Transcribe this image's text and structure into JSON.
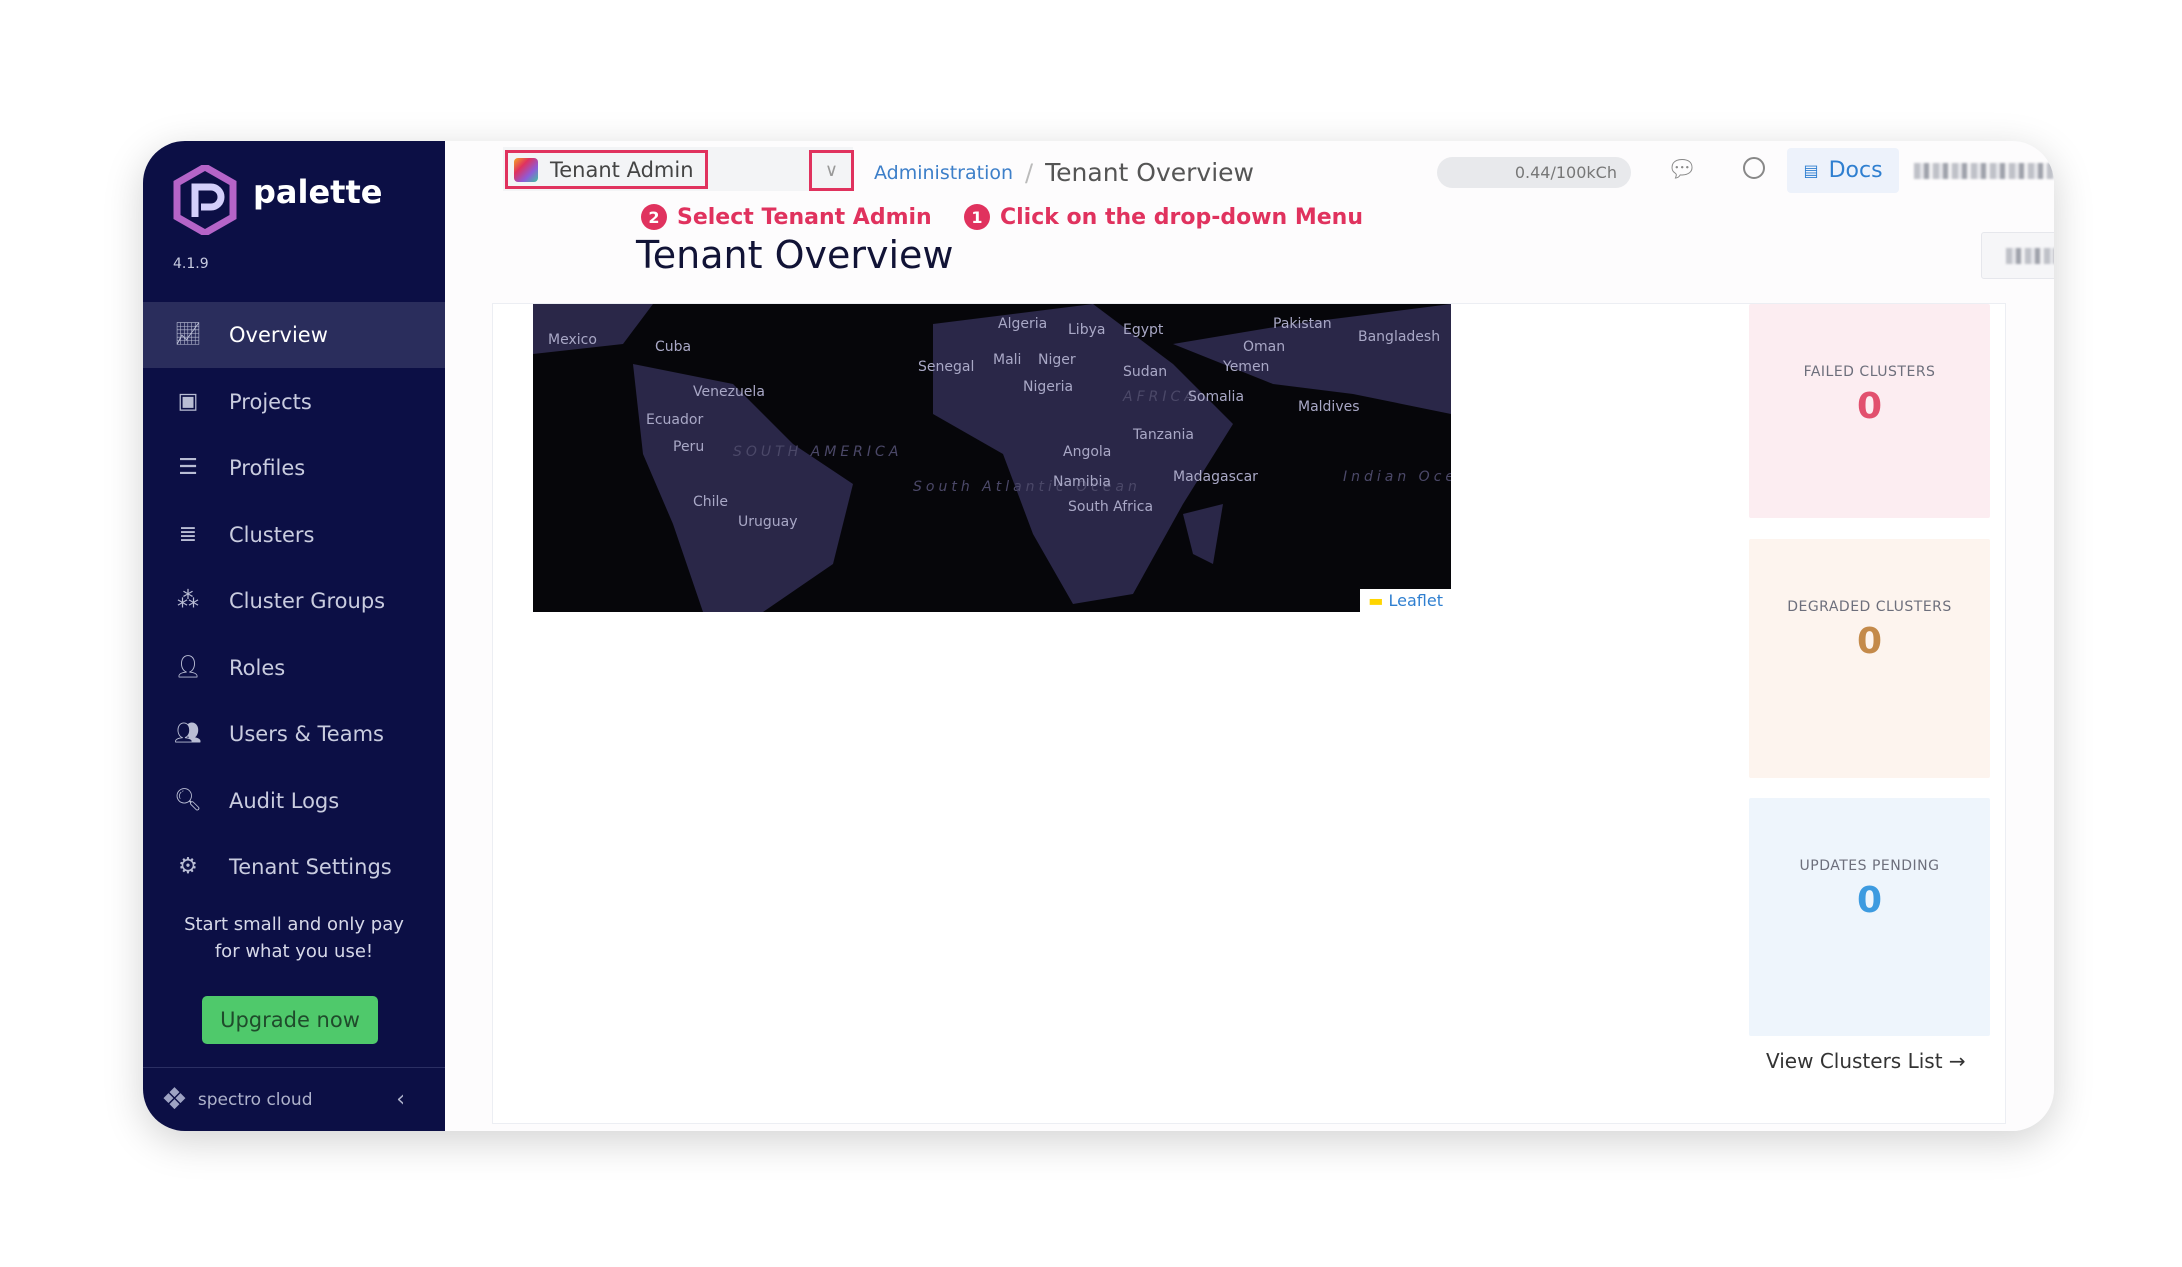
{
  "app": {
    "name": "palette",
    "version": "4.1.9"
  },
  "sidebar": {
    "items": [
      {
        "label": "Overview",
        "icon": "chart-line-icon",
        "active": true
      },
      {
        "label": "Projects",
        "icon": "bar-chart-icon"
      },
      {
        "label": "Profiles",
        "icon": "database-icon"
      },
      {
        "label": "Clusters",
        "icon": "server-icon"
      },
      {
        "label": "Cluster Groups",
        "icon": "network-icon"
      },
      {
        "label": "Roles",
        "icon": "user-lock-icon"
      },
      {
        "label": "Users & Teams",
        "icon": "users-icon"
      },
      {
        "label": "Audit Logs",
        "icon": "file-search-icon"
      },
      {
        "label": "Tenant Settings",
        "icon": "gear-icon"
      }
    ],
    "promo": "Start small and only pay for what you use!",
    "upgrade": "Upgrade now",
    "footer_brand": "spectro cloud"
  },
  "header": {
    "scope": "Tenant Admin",
    "breadcrumb": [
      "Administration",
      "Tenant Overview"
    ],
    "usage": "0.44/100kCh",
    "docs": "Docs"
  },
  "annotations": [
    {
      "num": "2",
      "text": "Select Tenant Admin"
    },
    {
      "num": "1",
      "text": "Click on the drop-down Menu"
    }
  ],
  "page": {
    "title": "Tenant Overview"
  },
  "map": {
    "attribution": "Leaflet",
    "labels": [
      "Mexico",
      "Cuba",
      "Venezuela",
      "Ecuador",
      "Peru",
      "SOUTH AMERICA",
      "Chile",
      "Uruguay",
      "South Atlantic Ocean",
      "Algeria",
      "Libya",
      "Egypt",
      "Senegal",
      "Mali",
      "Niger",
      "Nigeria",
      "Sudan",
      "AFRICA",
      "Angola",
      "Namibia",
      "South Africa",
      "Tanzania",
      "Somalia",
      "Madagascar",
      "Yemen",
      "Oman",
      "Pakistan",
      "Bangladesh",
      "Maldives",
      "Indian Ocean"
    ]
  },
  "stats": [
    {
      "label": "FAILED CLUSTERS",
      "value": "0",
      "color": "#e2506e",
      "bg": "#fcedf1"
    },
    {
      "label": "DEGRADED CLUSTERS",
      "value": "0",
      "color": "#c48a4a",
      "bg": "#fdf4ee"
    },
    {
      "label": "UPDATES PENDING",
      "value": "0",
      "color": "#3d9be0",
      "bg": "#eef5fc"
    }
  ],
  "view_clusters": "View Clusters List →"
}
